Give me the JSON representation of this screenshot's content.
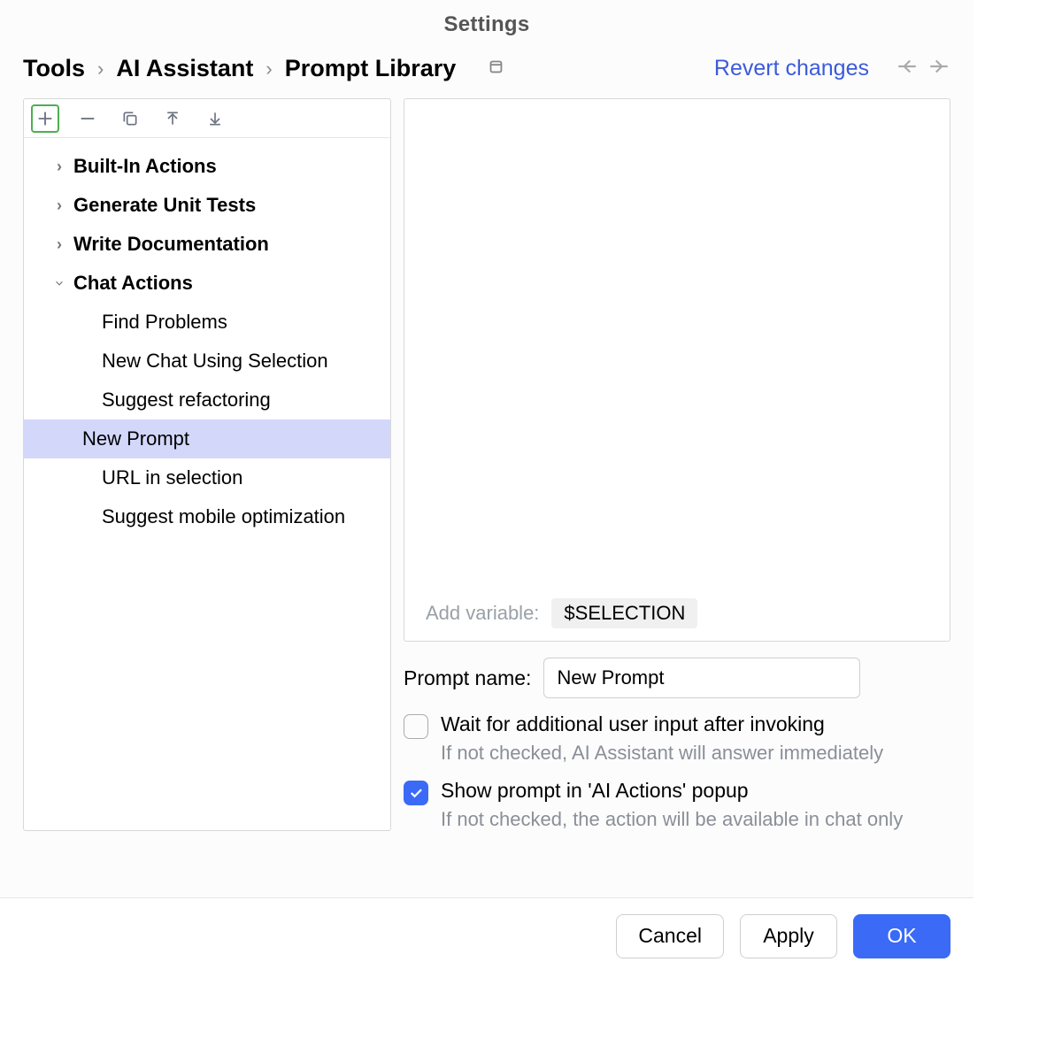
{
  "window": {
    "title": "Settings"
  },
  "breadcrumb": {
    "items": [
      "Tools",
      "AI Assistant",
      "Prompt Library"
    ]
  },
  "actions": {
    "revert": "Revert changes"
  },
  "tree": {
    "groups": [
      {
        "label": "Built-In Actions",
        "expanded": false,
        "children": []
      },
      {
        "label": "Generate Unit Tests",
        "expanded": false,
        "children": []
      },
      {
        "label": "Write Documentation",
        "expanded": false,
        "children": []
      },
      {
        "label": "Chat Actions",
        "expanded": true,
        "children": [
          {
            "label": "Find Problems",
            "selected": false
          },
          {
            "label": "New Chat Using Selection",
            "selected": false
          },
          {
            "label": "Suggest refactoring",
            "selected": false
          },
          {
            "label": "New Prompt",
            "selected": true
          },
          {
            "label": "URL in selection",
            "selected": false
          },
          {
            "label": "Suggest mobile optimization",
            "selected": false
          }
        ]
      }
    ]
  },
  "editor": {
    "add_variable_label": "Add variable:",
    "variable_chip": "$SELECTION"
  },
  "form": {
    "prompt_name_label": "Prompt name:",
    "prompt_name_value": "New Prompt",
    "wait_input": {
      "label": "Wait for additional user input after invoking",
      "checked": false,
      "help": "If not checked, AI Assistant will answer immediately"
    },
    "show_in_popup": {
      "label": "Show prompt in 'AI Actions' popup",
      "checked": true,
      "help": "If not checked, the action will be available in chat only"
    }
  },
  "footer": {
    "cancel": "Cancel",
    "apply": "Apply",
    "ok": "OK"
  }
}
